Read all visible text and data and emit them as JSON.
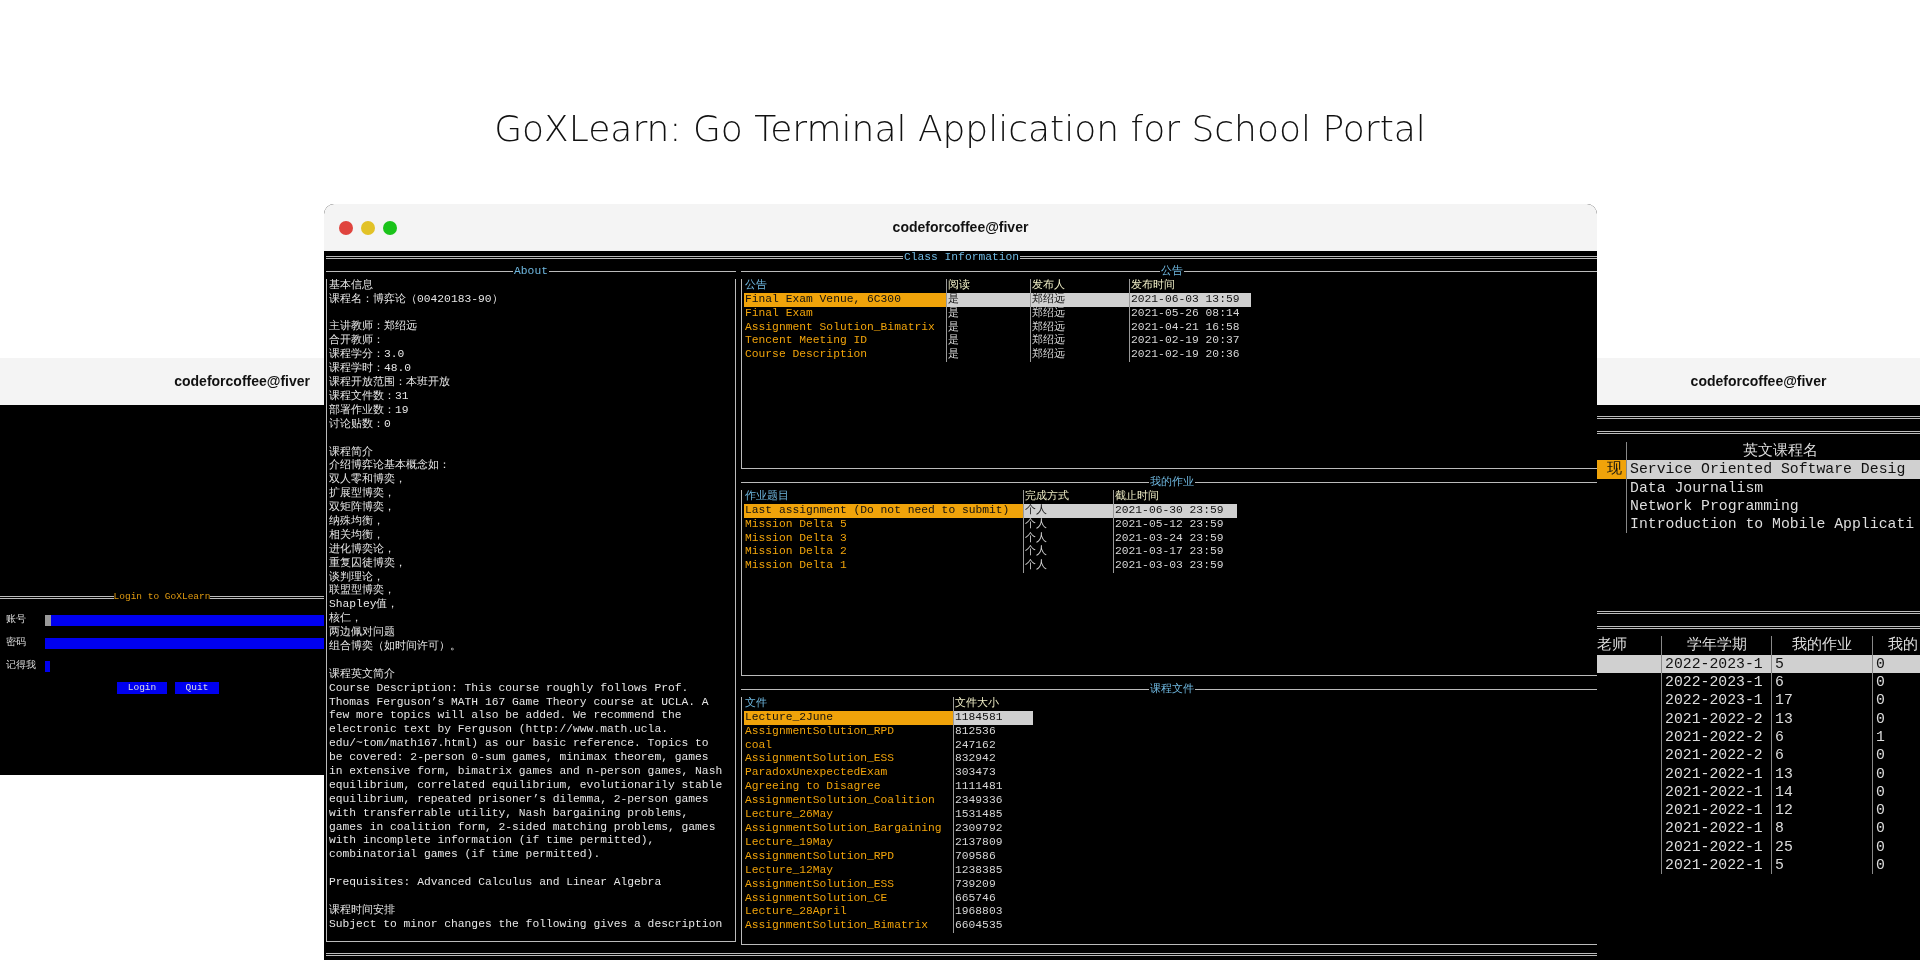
{
  "page_title": "GoXLearn: Go Terminal Application for School Portal",
  "login_window": {
    "title": "codeforcoffee@fiver",
    "form_title": "Login to GoXLearn",
    "fields": [
      {
        "label": "账号",
        "focused": true
      },
      {
        "label": "密码",
        "focused": false
      }
    ],
    "remember": {
      "label": "记得我",
      "checked": false
    },
    "buttons": [
      "Login",
      "Quit"
    ]
  },
  "class_window": {
    "title": "codeforcoffee@fiver",
    "frame_title": "Class Information",
    "about": {
      "title": "About",
      "blocks": [
        [
          "基本信息",
          "课程名：博弈论（00420183-90）"
        ],
        [
          "主讲教师：郑绍远",
          "合开教师：",
          "课程学分：3.0",
          "课程学时：48.0",
          "课程开放范围：本班开放",
          "课程文件数：31",
          "部署作业数：19",
          "讨论贴数：0"
        ],
        [
          "课程简介",
          "介绍博弈论基本概念如：",
          "双人零和博奕，",
          "扩展型博奕，",
          "双矩阵博奕，",
          "纳殊均衡，",
          "相关均衡，",
          "进化博奕论，",
          "重复囚徒博奕，",
          "谈判理论，",
          "联盟型博奕，",
          "Shapley值，",
          "核仁，",
          "两边佩对问题",
          "组合博奕（如时间许可）。"
        ],
        [
          "课程英文简介",
          "Course Description: This course roughly follows Prof.",
          "Thomas Ferguson’s MATH 167 Game Theory course at UCLA. A",
          "few more topics will also be added. We recommend the",
          "electronic text by Ferguson (http://www.math.ucla.",
          "edu/~tom/math167.html) as our basic reference. Topics to",
          "be covered: 2-person 0-sum games, minimax theorem, games",
          "in extensive form, bimatrix games and n-person games, Nash",
          "equilibrium, correlated equilibrium, evolutionarily stable",
          "equilibrium, repeated prisoner’s dilemma, 2-person games",
          "with transferrable utility, Nash bargaining problems,",
          "games in coalition form, 2-sided matching problems, games",
          "with incomplete information (if time permitted),",
          "combinatorial games (if time permitted)."
        ],
        [
          "Prequisites: Advanced Calculus and Linear Algebra"
        ],
        [
          "课程时间安排",
          "Subject to minor changes the following gives a description"
        ]
      ]
    },
    "panels": [
      {
        "title": "公告",
        "columns": [
          "公告",
          "阅读",
          "发布人",
          "发布时间"
        ],
        "rows": [
          {
            "cells": [
              "Final Exam Venue, 6C300",
              "是",
              "郑绍远",
              "2021-06-03 13:59"
            ],
            "selected": true
          },
          {
            "cells": [
              "Final Exam",
              "是",
              "郑绍远",
              "2021-05-26 08:14"
            ],
            "selected": false
          },
          {
            "cells": [
              "Assignment Solution_Bimatrix",
              "是",
              "郑绍远",
              "2021-04-21 16:58"
            ],
            "selected": false
          },
          {
            "cells": [
              "Tencent Meeting ID",
              "是",
              "郑绍远",
              "2021-02-19 20:37"
            ],
            "selected": false
          },
          {
            "cells": [
              "Course Description",
              "是",
              "郑绍远",
              "2021-02-19 20:36"
            ],
            "selected": false
          }
        ]
      },
      {
        "title": "我的作业",
        "columns": [
          "作业题目",
          "完成方式",
          "截止时间"
        ],
        "rows": [
          {
            "cells": [
              "Last assignment (Do not need to submit)",
              "个人",
              "2021-06-30 23:59"
            ],
            "selected": true
          },
          {
            "cells": [
              "Mission Delta 5",
              "个人",
              "2021-05-12 23:59"
            ],
            "selected": false
          },
          {
            "cells": [
              "Mission Delta 3",
              "个人",
              "2021-03-24 23:59"
            ],
            "selected": false
          },
          {
            "cells": [
              "Mission Delta 2",
              "个人",
              "2021-03-17 23:59"
            ],
            "selected": false
          },
          {
            "cells": [
              "Mission Delta 1",
              "个人",
              "2021-03-03 23:59"
            ],
            "selected": false
          }
        ]
      },
      {
        "title": "课程文件",
        "columns": [
          "文件",
          "文件大小"
        ],
        "rows": [
          {
            "cells": [
              "Lecture_2June",
              "1184581"
            ],
            "selected": true
          },
          {
            "cells": [
              "AssignmentSolution_RPD",
              "812536"
            ],
            "selected": false
          },
          {
            "cells": [
              "coal",
              "247162"
            ],
            "selected": false
          },
          {
            "cells": [
              "AssignmentSolution_ESS",
              "832942"
            ],
            "selected": false
          },
          {
            "cells": [
              "ParadoxUnexpectedExam",
              "303473"
            ],
            "selected": false
          },
          {
            "cells": [
              "Agreeing to Disagree",
              "1111481"
            ],
            "selected": false
          },
          {
            "cells": [
              "AssignmentSolution_Coalition",
              "2349336"
            ],
            "selected": false
          },
          {
            "cells": [
              "Lecture_26May",
              "1531485"
            ],
            "selected": false
          },
          {
            "cells": [
              "AssignmentSolution_Bargaining",
              "2309792"
            ],
            "selected": false
          },
          {
            "cells": [
              "Lecture_19May",
              "2137809"
            ],
            "selected": false
          },
          {
            "cells": [
              "AssignmentSolution_RPD",
              "709586"
            ],
            "selected": false
          },
          {
            "cells": [
              "Lecture_12May",
              "1238385"
            ],
            "selected": false
          },
          {
            "cells": [
              "AssignmentSolution_ESS",
              "739209"
            ],
            "selected": false
          },
          {
            "cells": [
              "AssignmentSolution_CE",
              "665746"
            ],
            "selected": false
          },
          {
            "cells": [
              "Lecture_28April",
              "1968803"
            ],
            "selected": false
          },
          {
            "cells": [
              "AssignmentSolution_Bimatrix",
              "6604535"
            ],
            "selected": false
          }
        ]
      }
    ]
  },
  "courses_window": {
    "title": "codeforcoffee@fiver",
    "course_table": {
      "columns": [
        "英文课程名"
      ],
      "rows": [
        {
          "code": "现",
          "name": "Service Oriented Software Desig",
          "selected": true
        },
        {
          "name": "Data Journalism",
          "selected": false
        },
        {
          "name": "Network Programming",
          "selected": false
        },
        {
          "name": "Introduction to Mobile Applicati",
          "selected": false
        }
      ]
    },
    "term_table": {
      "columns": [
        "老师",
        "学年学期",
        "我的作业",
        "我的"
      ],
      "rows": [
        {
          "cells": [
            "",
            "2022-2023-1",
            "5",
            "0"
          ],
          "selected": true
        },
        {
          "cells": [
            "",
            "2022-2023-1",
            "6",
            "0"
          ],
          "selected": false
        },
        {
          "cells": [
            "",
            "2022-2023-1",
            "17",
            "0"
          ],
          "selected": false
        },
        {
          "cells": [
            "",
            "2021-2022-2",
            "13",
            "0"
          ],
          "selected": false
        },
        {
          "cells": [
            "",
            "2021-2022-2",
            "6",
            "1"
          ],
          "selected": false
        },
        {
          "cells": [
            "",
            "2021-2022-2",
            "6",
            "0"
          ],
          "selected": false
        },
        {
          "cells": [
            "",
            "2021-2022-1",
            "13",
            "0"
          ],
          "selected": false
        },
        {
          "cells": [
            "",
            "2021-2022-1",
            "14",
            "0"
          ],
          "selected": false
        },
        {
          "cells": [
            "",
            "2021-2022-1",
            "12",
            "0"
          ],
          "selected": false
        },
        {
          "cells": [
            "",
            "2021-2022-1",
            "8",
            "0"
          ],
          "selected": false
        },
        {
          "cells": [
            "",
            "2021-2022-1",
            "25",
            "0"
          ],
          "selected": false
        },
        {
          "cells": [
            "",
            "2021-2022-1",
            "5",
            "0"
          ],
          "selected": false
        }
      ]
    }
  }
}
